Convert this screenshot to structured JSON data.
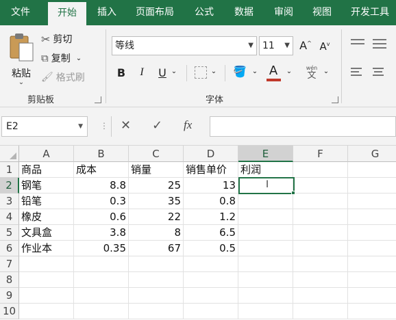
{
  "tabs": [
    "文件",
    "开始",
    "插入",
    "页面布局",
    "公式",
    "数据",
    "审阅",
    "视图",
    "开发工具"
  ],
  "active_tab": "开始",
  "ribbon": {
    "paste_label": "粘贴",
    "cut_label": "剪切",
    "copy_label": "复制",
    "format_painter_label": "格式刷",
    "clipboard_group": "剪贴板",
    "font_name": "等线",
    "font_size": "11",
    "font_group": "字体",
    "bold": "B",
    "italic": "I",
    "underline": "U",
    "font_color_letter": "A",
    "font_color_hex": "#c0392b",
    "phonetic_top": "wén",
    "phonetic_bottom": "文",
    "grow_font": "A",
    "shrink_font": "A"
  },
  "formula_bar": {
    "name_box": "E2",
    "cancel": "✕",
    "enter": "✓",
    "fx": "fx",
    "content": ""
  },
  "sheet": {
    "columns": [
      "A",
      "B",
      "C",
      "D",
      "E",
      "F",
      "G"
    ],
    "rows": [
      "1",
      "2",
      "3",
      "4",
      "5",
      "6",
      "7",
      "8",
      "9",
      "10"
    ],
    "selected_cell": "E2",
    "data": [
      [
        "商品",
        "成本",
        "销量",
        "销售单价",
        "利润"
      ],
      [
        "钢笔",
        "8.8",
        "25",
        "13",
        ""
      ],
      [
        "铅笔",
        "0.3",
        "35",
        "0.8",
        ""
      ],
      [
        "橡皮",
        "0.6",
        "22",
        "1.2",
        ""
      ],
      [
        "文具盒",
        "3.8",
        "8",
        "6.5",
        ""
      ],
      [
        "作业本",
        "0.35",
        "67",
        "0.5",
        ""
      ]
    ]
  },
  "colors": {
    "accent": "#217346",
    "ribbon_bg": "#f3f3f3"
  }
}
